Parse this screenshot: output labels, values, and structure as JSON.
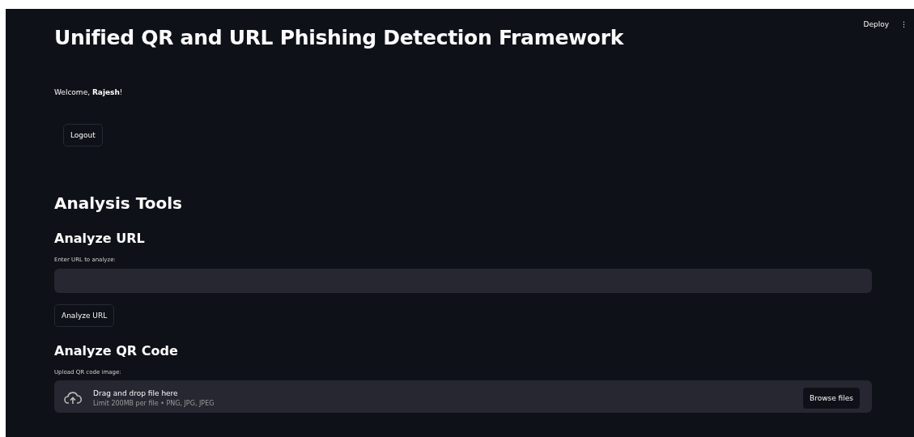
{
  "header": {
    "deploy": "Deploy",
    "menu": "⋮"
  },
  "title": "Unified QR and URL Phishing Detection Framework",
  "welcome": "Welcome, **Rajesh**!",
  "logout": "Logout",
  "section": "Analysis Tools",
  "url_panel": {
    "heading": "Analyze URL",
    "label": "Enter URL to analyze:",
    "button": "Analyze URL"
  },
  "qr_panel": {
    "heading": "Analyze QR Code",
    "label": "Upload QR code image:",
    "drop_title": "Drag and drop file here",
    "drop_hint": "Limit 200MB per file • PNG, JPG, JPEG",
    "button": "Browse files"
  }
}
